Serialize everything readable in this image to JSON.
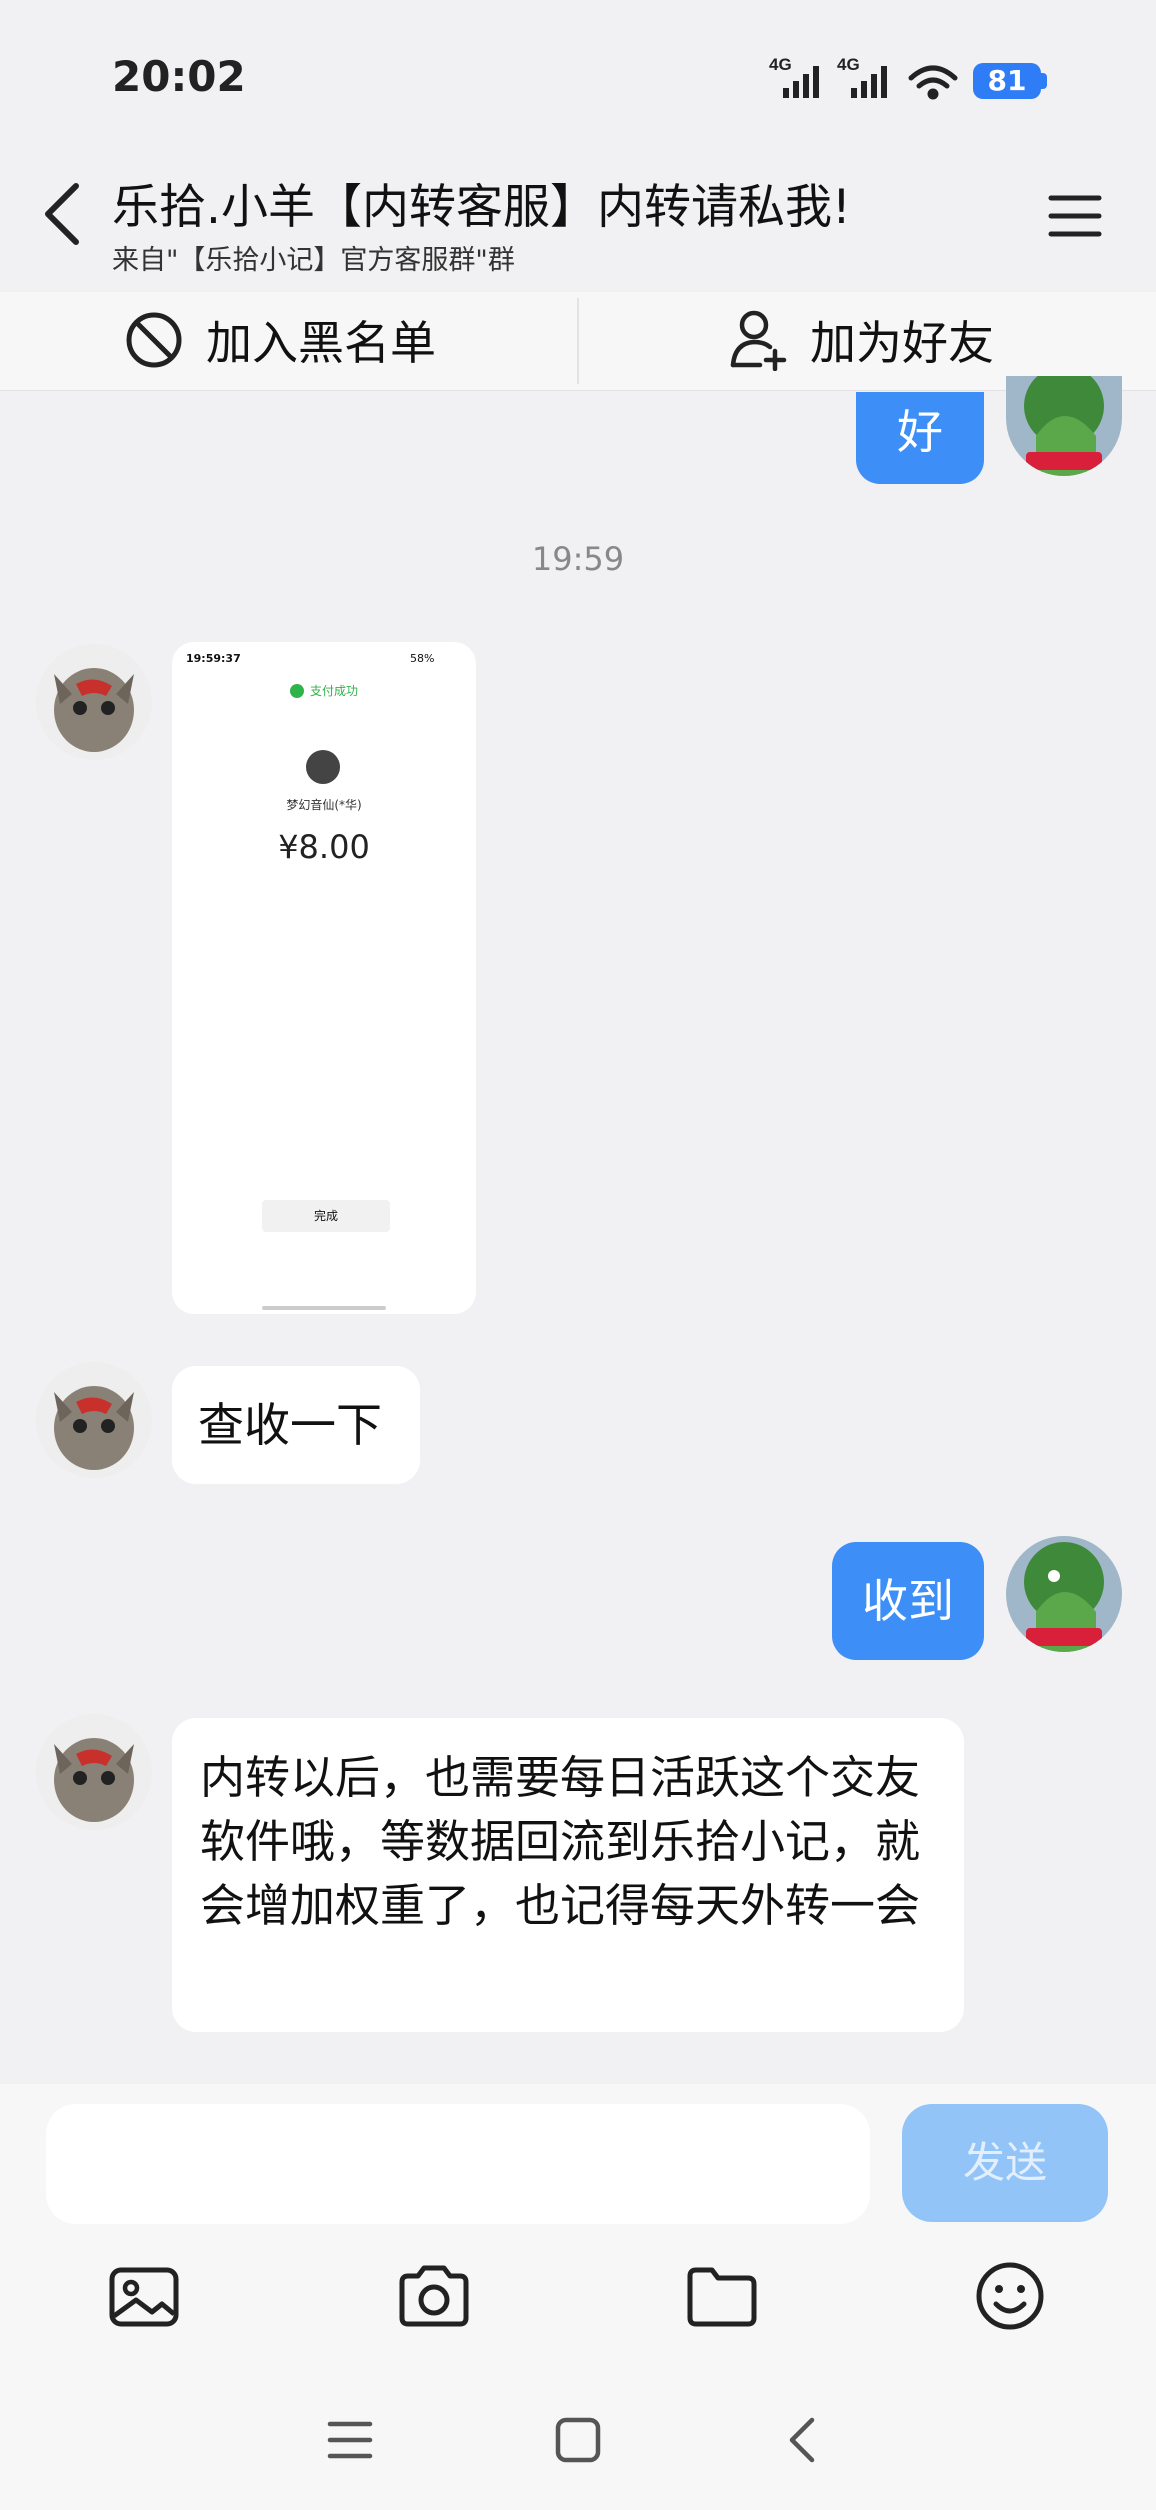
{
  "status_bar": {
    "time": "20:02",
    "signal1_label": "4G",
    "signal2_label": "4G",
    "battery": "81",
    "icons": [
      "signal-icon",
      "signal-icon",
      "wifi-icon",
      "battery-icon"
    ]
  },
  "header": {
    "title": "乐拾.小羊【内转客服】内转请私我!",
    "subtitle": "来自\"【乐拾小记】官方客服群\"群",
    "back_icon": "chevron-left-icon",
    "menu_icon": "hamburger-icon"
  },
  "actions": {
    "block_label": "加入黑名单",
    "add_friend_label": "加为好友"
  },
  "chat": {
    "messages": [
      {
        "from": "me",
        "type": "text",
        "text": "好"
      },
      {
        "type": "timestamp",
        "text": "19:59"
      },
      {
        "from": "other",
        "type": "image",
        "image": {
          "status_time": "19:59:37",
          "status_right": "58%",
          "pay_status": "支付成功",
          "payee": "梦幻音仙(*华)",
          "amount": "¥8.00",
          "done_label": "完成"
        }
      },
      {
        "from": "other",
        "type": "text",
        "text": "查收一下"
      },
      {
        "from": "me",
        "type": "text",
        "text": "收到"
      },
      {
        "from": "other",
        "type": "text",
        "text": "内转以后，也需要每日活跃这个交友软件哦，等数据回流到乐拾小记，就会增加权重了，也记得每天外转一会"
      }
    ]
  },
  "input": {
    "placeholder": "",
    "send_label": "发送"
  },
  "toolbar": [
    "image-icon",
    "camera-icon",
    "folder-icon",
    "emoji-icon"
  ],
  "navbar": [
    "menu-nav-icon",
    "home-nav-icon",
    "back-nav-icon"
  ],
  "colors": {
    "accent": "#3d8ff7",
    "send_disabled": "#93c4f7",
    "background": "#f1f1f3"
  }
}
